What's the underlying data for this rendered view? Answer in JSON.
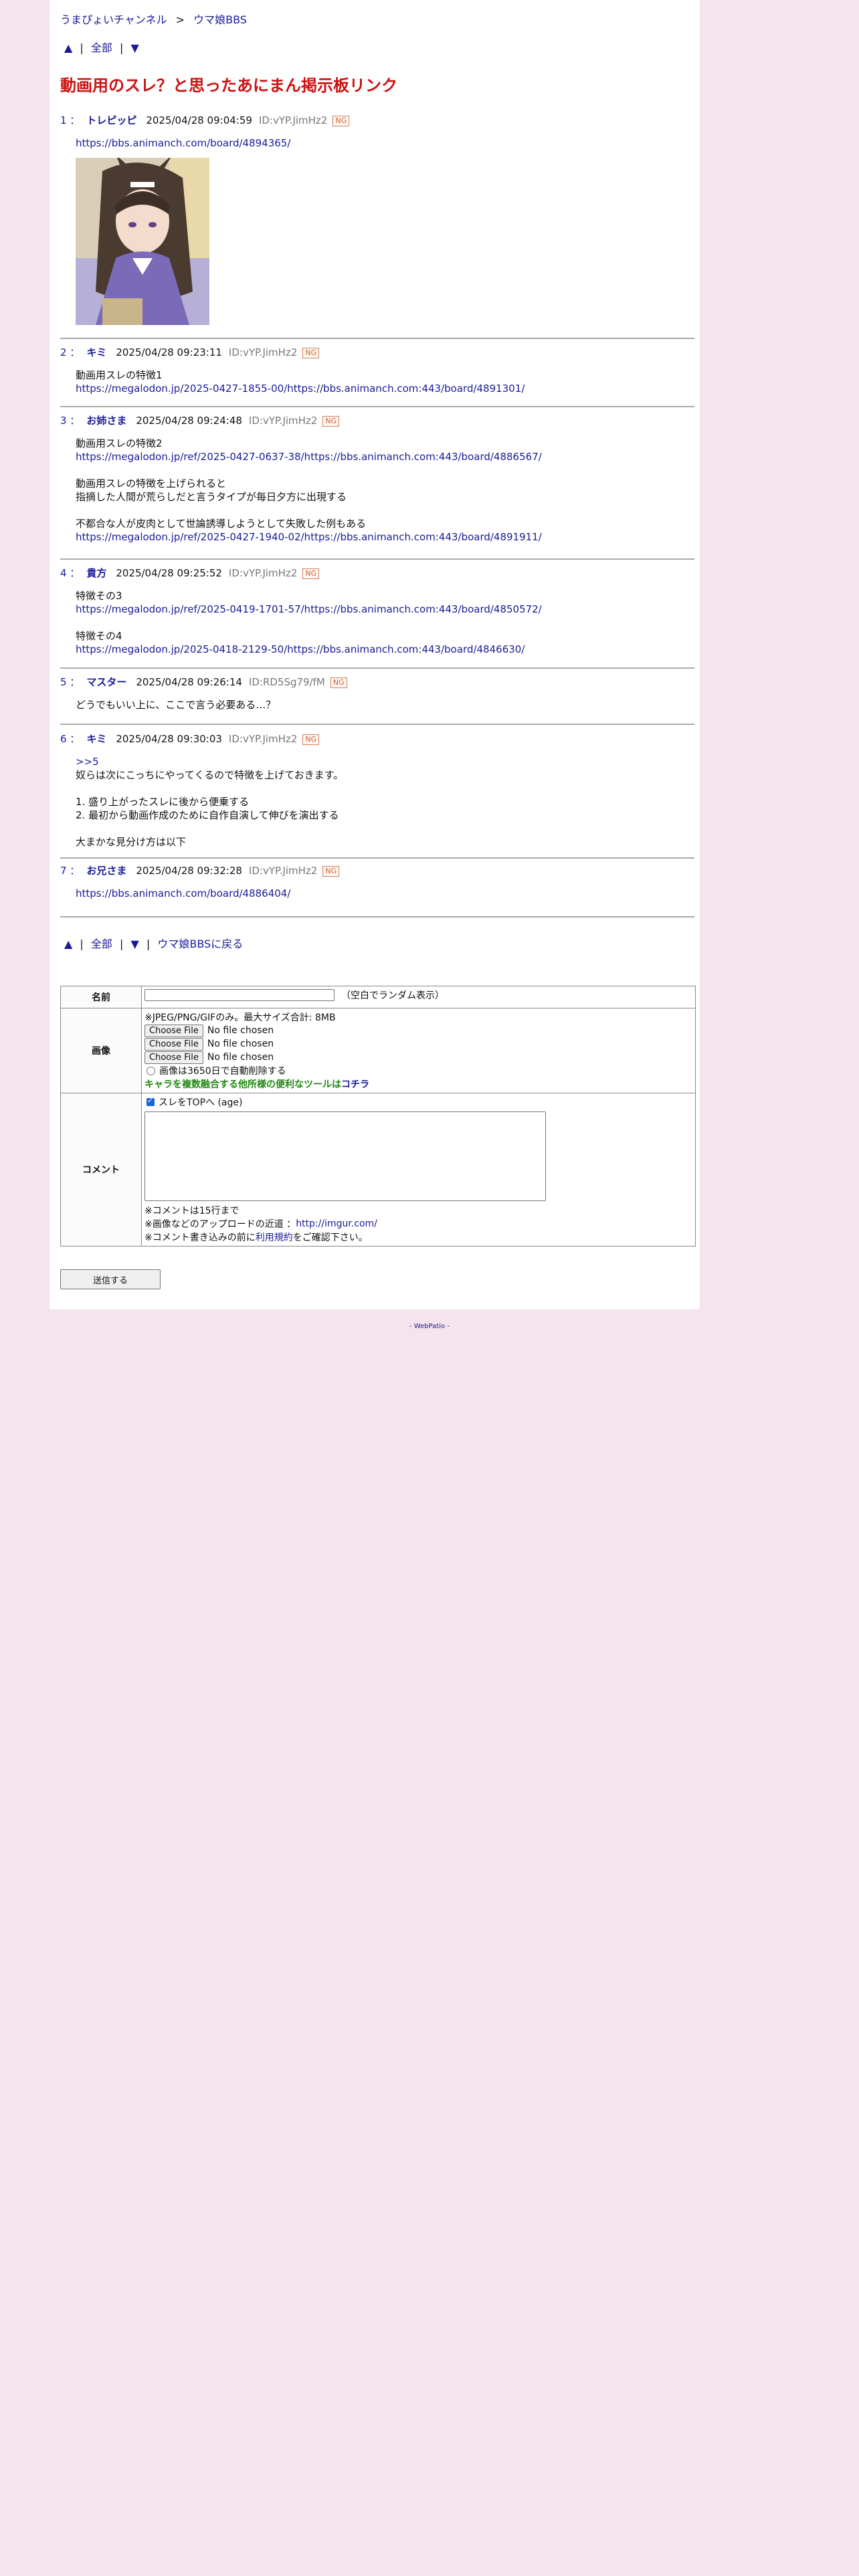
{
  "breadcrumb": {
    "home": "うまぴょいチャンネル",
    "sep": ">",
    "board": "ウマ娘BBS"
  },
  "topnav": {
    "up": "▲",
    "all": "全部",
    "down": "▼",
    "bar": "|"
  },
  "thread_title": "動画用のスレ？と思ったあにまん掲示板リンク",
  "ng_label": "NG",
  "posts": [
    {
      "num": "1 ：",
      "name": "トレピッピ",
      "date": "2025/04/28 09:04:59",
      "id": "ID:vYP.JimHz2",
      "lines": [
        "https://bbs.animanch.com/board/4894365/"
      ],
      "link_lines": [
        0
      ],
      "has_image": true
    },
    {
      "num": "2 ：",
      "name": "キミ",
      "date": "2025/04/28 09:23:11",
      "id": "ID:vYP.JimHz2",
      "lines": [
        "動画用スレの特徴1",
        "https://megalodon.jp/2025-0427-1855-00/https://bbs.animanch.com:443/board/4891301/"
      ],
      "link_lines": [
        1
      ]
    },
    {
      "num": "3 ：",
      "name": "お姉さま",
      "date": "2025/04/28 09:24:48",
      "id": "ID:vYP.JimHz2",
      "lines": [
        "動画用スレの特徴2",
        "https://megalodon.jp/ref/2025-0427-0637-38/https://bbs.animanch.com:443/board/4886567/",
        "",
        "動画用スレの特徴を上げられると",
        "指摘した人間が荒らしだと言うタイプが毎日夕方に出現する",
        "",
        "不都合な人が皮肉として世論誘導しようとして失敗した例もある",
        "https://megalodon.jp/ref/2025-0427-1940-02/https://bbs.animanch.com:443/board/4891911/"
      ],
      "link_lines": [
        1,
        7
      ]
    },
    {
      "num": "4 ：",
      "name": "貴方",
      "date": "2025/04/28 09:25:52",
      "id": "ID:vYP.JimHz2",
      "lines": [
        "特徴その3",
        "https://megalodon.jp/ref/2025-0419-1701-57/https://bbs.animanch.com:443/board/4850572/",
        "",
        "特徴その4",
        "https://megalodon.jp/2025-0418-2129-50/https://bbs.animanch.com:443/board/4846630/"
      ],
      "link_lines": [
        1,
        4
      ]
    },
    {
      "num": "5 ：",
      "name": "マスター",
      "date": "2025/04/28 09:26:14",
      "id": "ID:RD5Sg79/fM",
      "lines": [
        "どうでもいい上に、ここで言う必要ある…？"
      ],
      "link_lines": []
    },
    {
      "num": "6 ：",
      "name": "キミ",
      "date": "2025/04/28 09:30:03",
      "id": "ID:vYP.JimHz2",
      "lines": [
        ">>5",
        "奴らは次にこっちにやってくるので特徴を上げておきます。",
        "",
        "1. 盛り上がったスレに後から便乗する",
        "2. 最初から動画作成のために自作自演して伸びを演出する",
        "",
        "大まかな見分け方は以下"
      ],
      "link_lines": [
        0
      ]
    },
    {
      "num": "7 ：",
      "name": "お兄さま",
      "date": "2025/04/28 09:32:28",
      "id": "ID:vYP.JimHz2",
      "lines": [
        "https://bbs.animanch.com/board/4886404/"
      ],
      "link_lines": [
        0
      ]
    }
  ],
  "botnav": {
    "up": "▲",
    "all": "全部",
    "down": "▼",
    "back": "ウマ娘BBSに戻る",
    "bar": "|"
  },
  "form": {
    "name_label": "名前",
    "name_hint": "（空白でランダム表示）",
    "image_label": "画像",
    "image_note": "※JPEG/PNG/GIFのみ。最大サイズ合計: 8MB",
    "choose_file": "Choose File",
    "no_file": "No file chosen",
    "auto_delete": "画像は3650日で自動削除する",
    "tool_note_green": "キャラを複数融合する他所様の便利なツールは",
    "tool_note_link": "コチラ",
    "comment_label": "コメント",
    "age_label": "スレをTOPへ (age)",
    "note1": "※コメントは15行まで",
    "note2_prefix": "※画像などのアップロードの近道 ： ",
    "note2_link": "http://imgur.com/",
    "note3_prefix": "※コメント書き込みの前に",
    "note3_link": "利用規約",
    "note3_suffix": "をご確認下さい。",
    "submit": "送信する"
  },
  "footer": "- WebPatio -"
}
